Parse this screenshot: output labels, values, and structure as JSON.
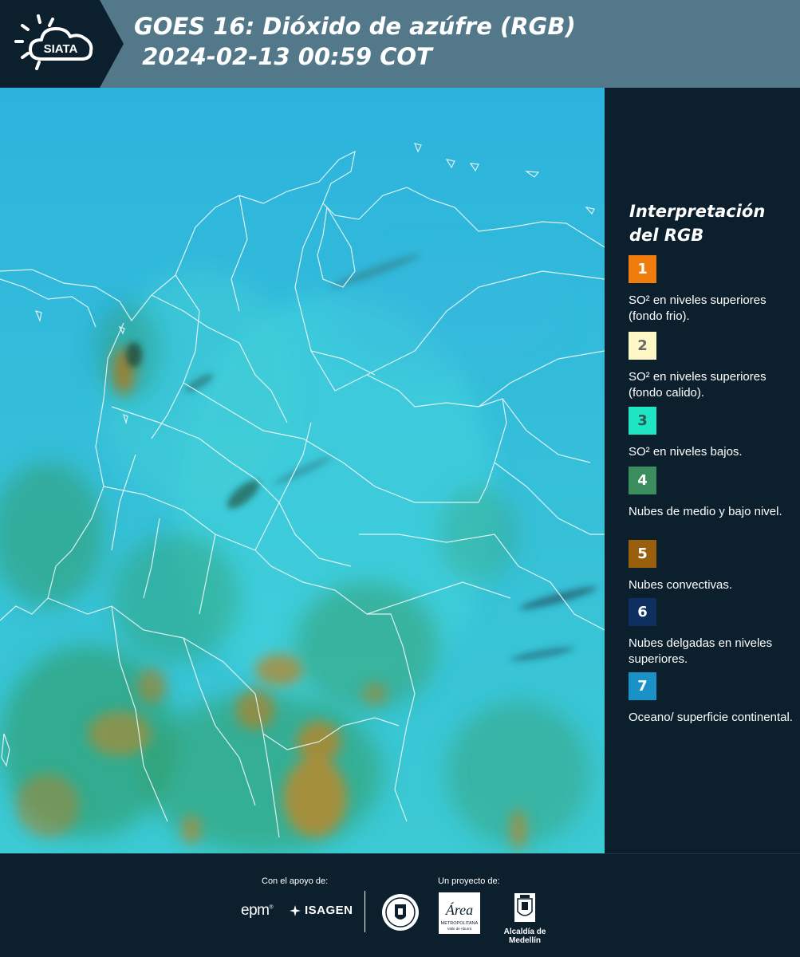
{
  "header": {
    "logo_text": "SIATA",
    "title_line1": "GOES 16: Dióxido de azúfre (RGB)",
    "title_line2": " 2024-02-13 00:59 COT"
  },
  "legend": {
    "title": "Interpretación del RGB",
    "items": [
      {
        "number": "1",
        "label": "SO² en niveles superiores (fondo frio).",
        "color": "#f07c0e",
        "text_color": "#ffffff"
      },
      {
        "number": "2",
        "label": "SO² en niveles superiores (fondo calido).",
        "color": "#fdf6c5",
        "text_color": "#6a6a6a"
      },
      {
        "number": "3",
        "label": "SO² en niveles bajos.",
        "color": "#1ee6c5",
        "text_color": "#2a5a55"
      },
      {
        "number": "4",
        "label": "Nubes de medio y bajo nivel.",
        "color": "#3a8d5d",
        "text_color": "#ffffff"
      },
      {
        "number": "5",
        "label": "Nubes convectivas.",
        "color": "#9a5f0c",
        "text_color": "#ffffff"
      },
      {
        "number": "6",
        "label": "Nubes delgadas en niveles superiores.",
        "color": "#0e2f60",
        "text_color": "#ffffff"
      },
      {
        "number": "7",
        "label": "Oceano/ superficie continental.",
        "color": "#1a92c8",
        "text_color": "#ffffff"
      }
    ]
  },
  "footer": {
    "support_label": "Con el apoyo de:",
    "project_label": "Un proyecto de:",
    "epm_text": "epm",
    "isagen_text": "ISAGEN",
    "area_text": "Área",
    "area_subtext": "METROPOLITANA",
    "area_subtext2": "Valle de Aburrá",
    "alcaldia_text": "Alcaldía de Medellín"
  },
  "colors": {
    "background": "#0b1f2c",
    "header": "#52788a",
    "ocean": "#2fb6dc",
    "land": "#3ec8d8"
  }
}
